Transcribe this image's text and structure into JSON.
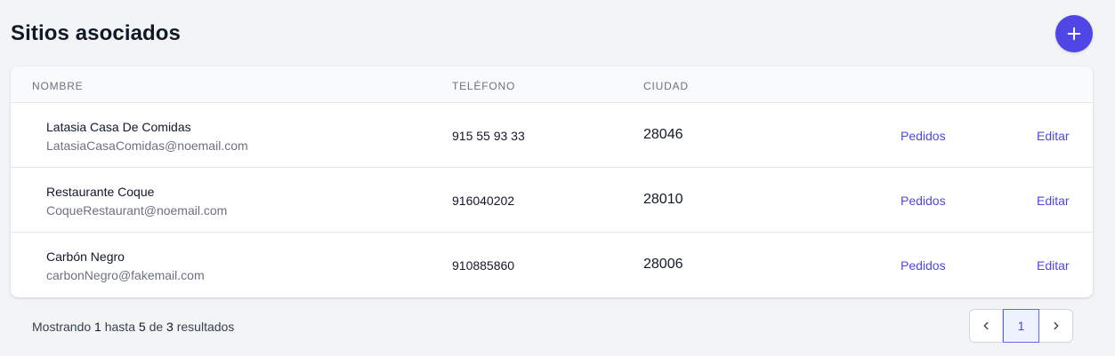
{
  "header": {
    "title": "Sitios asociados",
    "add_icon": "plus-icon"
  },
  "colors": {
    "accent": "#4f46e5",
    "background": "#f3f4f6"
  },
  "table": {
    "columns": [
      "Nombre",
      "Teléfono",
      "Ciudad"
    ],
    "rows": [
      {
        "name": "Latasia Casa De Comidas",
        "email": "LatasiaCasaComidas@noemail.com",
        "phone": "915 55 93 33",
        "city": "28046",
        "orders_label": "Pedidos",
        "edit_label": "Editar"
      },
      {
        "name": "Restaurante Coque",
        "email": "CoqueRestaurant@noemail.com",
        "phone": "916040202",
        "city": "28010",
        "orders_label": "Pedidos",
        "edit_label": "Editar"
      },
      {
        "name": "Carbón Negro",
        "email": "carbonNegro@fakemail.com",
        "phone": "910885860",
        "city": "28006",
        "orders_label": "Pedidos",
        "edit_label": "Editar"
      }
    ]
  },
  "footer": {
    "prefix": "Mostrando",
    "from": "1",
    "to_word": "hasta",
    "to": "5",
    "of_word": "de",
    "total": "3",
    "suffix": "resultados"
  },
  "pagination": {
    "current_page": "1",
    "prev_icon": "chevron-left-icon",
    "next_icon": "chevron-right-icon"
  }
}
